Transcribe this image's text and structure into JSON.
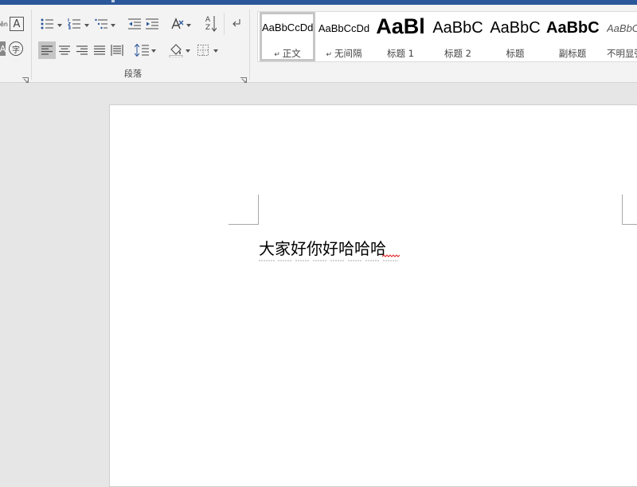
{
  "window": {
    "accent_color": "#2b579a"
  },
  "ribbon": {
    "font_group": {
      "phonetic_icon": "phonetic-guide-icon",
      "phonetic_glyph": "ěn",
      "char_border_icon": "character-border-icon",
      "char_border_glyph": "A",
      "enclose_char_icon": "enclose-characters-icon",
      "enclose_char_glyph": "字",
      "left_partial_glyph": "A"
    },
    "paragraph_group": {
      "label": "段落",
      "buttons": [
        "bullets",
        "numbering",
        "multilevel-list",
        "decrease-indent",
        "increase-indent",
        "asian-layout",
        "sort",
        "show-formatting",
        "align-left",
        "center",
        "align-right",
        "justify",
        "distributed",
        "line-spacing",
        "shading",
        "borders"
      ],
      "sort_glyph_top": "A",
      "sort_glyph_bottom": "Z",
      "selected_alignment": "align-left"
    },
    "styles": [
      {
        "sample": "AaBbCcDd",
        "name": "正文",
        "selected": true,
        "paragraph_mark": true
      },
      {
        "sample": "AaBbCcDd",
        "name": "无间隔",
        "selected": false,
        "paragraph_mark": true
      },
      {
        "sample": "AaBl",
        "name": "标题 1",
        "selected": false
      },
      {
        "sample": "AaBbC",
        "name": "标题 2",
        "selected": false
      },
      {
        "sample": "AaBbC",
        "name": "标题",
        "selected": false
      },
      {
        "sample": "AaBbC",
        "name": "副标题",
        "selected": false
      },
      {
        "sample": "AaBbCcD",
        "name": "不明显强调",
        "selected": false
      }
    ],
    "paragraph_mark_glyph": "↵"
  },
  "document": {
    "text": "大家好你好哈哈哈",
    "spelling_error_word": "哈",
    "error_color": "#e02020"
  }
}
